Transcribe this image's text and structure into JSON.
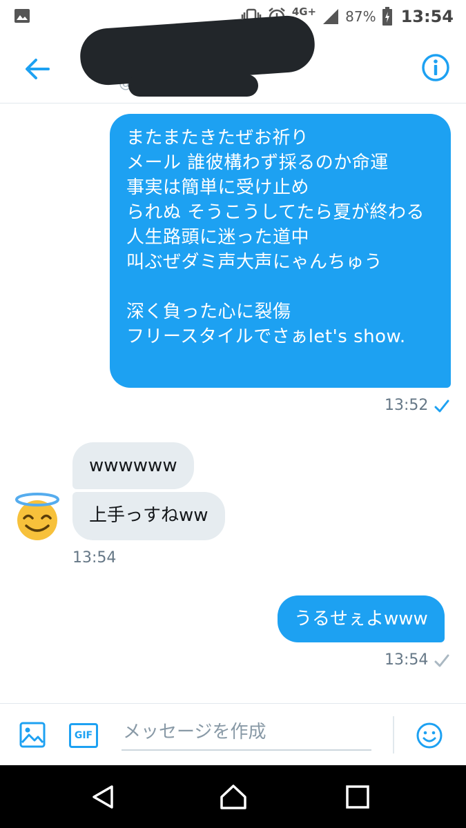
{
  "status_bar": {
    "network": "4G+",
    "battery": "87%",
    "time": "13:54"
  },
  "header": {
    "handle_prefix": "@"
  },
  "messages": [
    {
      "direction": "outgoing",
      "text": "またまたきたぜお祈り\nメール 誰彼構わず採るのか命運\n事実は簡単に受け止め\nられぬ そうこうしてたら夏が終わる\n人生路頭に迷った道中\n叫ぶぜダミ声大声にゃんちゅう\n\n深く負った心に裂傷\nフリースタイルでさぁlet's show.",
      "time": "13:52",
      "status": "read"
    },
    {
      "direction": "incoming",
      "text": "wwwwww"
    },
    {
      "direction": "incoming",
      "text": "上手っすねww",
      "time": "13:54"
    },
    {
      "direction": "outgoing",
      "text": "うるせぇよwww",
      "time": "13:54",
      "status": "sent"
    }
  ],
  "composer": {
    "gif_label": "GIF",
    "placeholder": "メッセージを作成"
  },
  "colors": {
    "accent": "#1da1f2",
    "incoming_bubble": "#e6ecf0",
    "timestamp": "#657786"
  },
  "icons": {
    "back": "arrow-left-icon",
    "info": "info-icon",
    "image": "image-icon",
    "emoji": "emoji-icon",
    "read": "check-icon"
  }
}
